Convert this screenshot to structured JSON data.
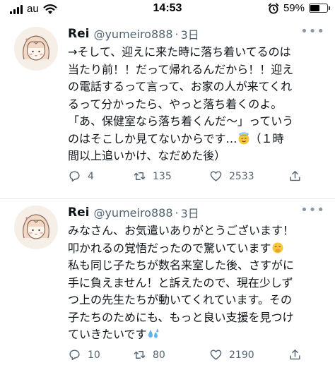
{
  "status_bar": {
    "carrier": "au",
    "time": "14:53",
    "battery": "59%",
    "battery_level": 0.59
  },
  "tweets": [
    {
      "name": "Rei",
      "handle": "@yumeiro888",
      "time": "3日",
      "lines": [
        "→そして、迎えに来た時に落ち着いてるのは",
        "当たり前！！だって帰れるんだから！！迎え",
        "の電話するって言って、お家の人が来てくれ",
        "るって分かったら、やっと落ち着くのよ。",
        "「あ、保健室なら落ち着くんだ〜」っていう",
        "のはそこしか見てないからです…",
        "（１時",
        "間以上追いかけ、なだめた後）"
      ],
      "emoji": "innocent-face",
      "replies": "4",
      "retweets": "135",
      "likes": "2533"
    },
    {
      "name": "Rei",
      "handle": "@yumeiro888",
      "time": "3日",
      "lines": [
        "みなさん、お気遣いありがとうございます！",
        "叩かれるの覚悟だったので驚いています",
        "私も同じ子たちが数名来室した後、さすがに",
        "手に負えません！と訴えたので、現在少しず",
        "つ上の先生たちが動いてくれています。その",
        "子たちのためにも、もっと良い支援を見つけ",
        "ていきたいです"
      ],
      "emoji_line2": "face-with-hand-over-mouth",
      "emoji_line7": "sweat-droplets",
      "replies": "10",
      "retweets": "80",
      "likes": "2190"
    }
  ]
}
